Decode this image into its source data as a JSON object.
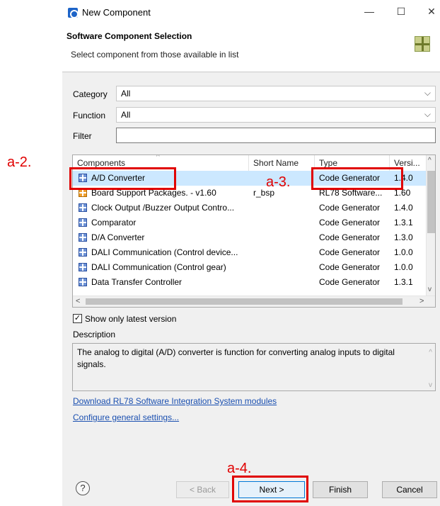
{
  "window": {
    "title": "New Component",
    "controls": {
      "minimize": "—",
      "maximize": "☐",
      "close": "✕"
    }
  },
  "header": {
    "title": "Software Component Selection",
    "subtitle": "Select component from those available in list",
    "icon": "component-grid-icon"
  },
  "form": {
    "category_label": "Category",
    "category_value": "All",
    "function_label": "Function",
    "function_value": "All",
    "filter_label": "Filter",
    "filter_value": ""
  },
  "table": {
    "columns": [
      "Components",
      "Short Name",
      "Type",
      "Versi..."
    ],
    "rows": [
      {
        "name": "A/D Converter",
        "short": "",
        "type": "Code Generator",
        "version": "1.4.0",
        "icon": "blue",
        "selected": true
      },
      {
        "name": "Board Support Packages. - v1.60",
        "short": "r_bsp",
        "type": "RL78 Software...",
        "version": "1.60",
        "icon": "orange",
        "selected": false
      },
      {
        "name": "Clock Output /Buzzer Output Contro...",
        "short": "",
        "type": "Code Generator",
        "version": "1.4.0",
        "icon": "blue",
        "selected": false
      },
      {
        "name": "Comparator",
        "short": "",
        "type": "Code Generator",
        "version": "1.3.1",
        "icon": "blue",
        "selected": false
      },
      {
        "name": "D/A Converter",
        "short": "",
        "type": "Code Generator",
        "version": "1.3.0",
        "icon": "blue",
        "selected": false
      },
      {
        "name": "DALI Communication (Control device...",
        "short": "",
        "type": "Code Generator",
        "version": "1.0.0",
        "icon": "blue",
        "selected": false
      },
      {
        "name": "DALI Communication (Control gear)",
        "short": "",
        "type": "Code Generator",
        "version": "1.0.0",
        "icon": "blue",
        "selected": false
      },
      {
        "name": "Data Transfer Controller",
        "short": "",
        "type": "Code Generator",
        "version": "1.3.1",
        "icon": "blue",
        "selected": false
      }
    ]
  },
  "options": {
    "show_latest_label": "Show only latest version",
    "show_latest_checked": true
  },
  "description": {
    "label": "Description",
    "text": "The analog to digital (A/D) converter is function for converting analog inputs to digital signals."
  },
  "links": {
    "download": "Download RL78 Software Integration System modules",
    "configure": "Configure general settings..."
  },
  "buttons": {
    "help": "?",
    "back": "< Back",
    "next": "Next >",
    "finish": "Finish",
    "cancel": "Cancel"
  },
  "annotations": {
    "a2": "a-2.",
    "a3": "a-3.",
    "a4": "a-4."
  },
  "colors": {
    "annotation": "#e00000",
    "selection": "#cce8ff",
    "link": "#1a4fb0"
  }
}
